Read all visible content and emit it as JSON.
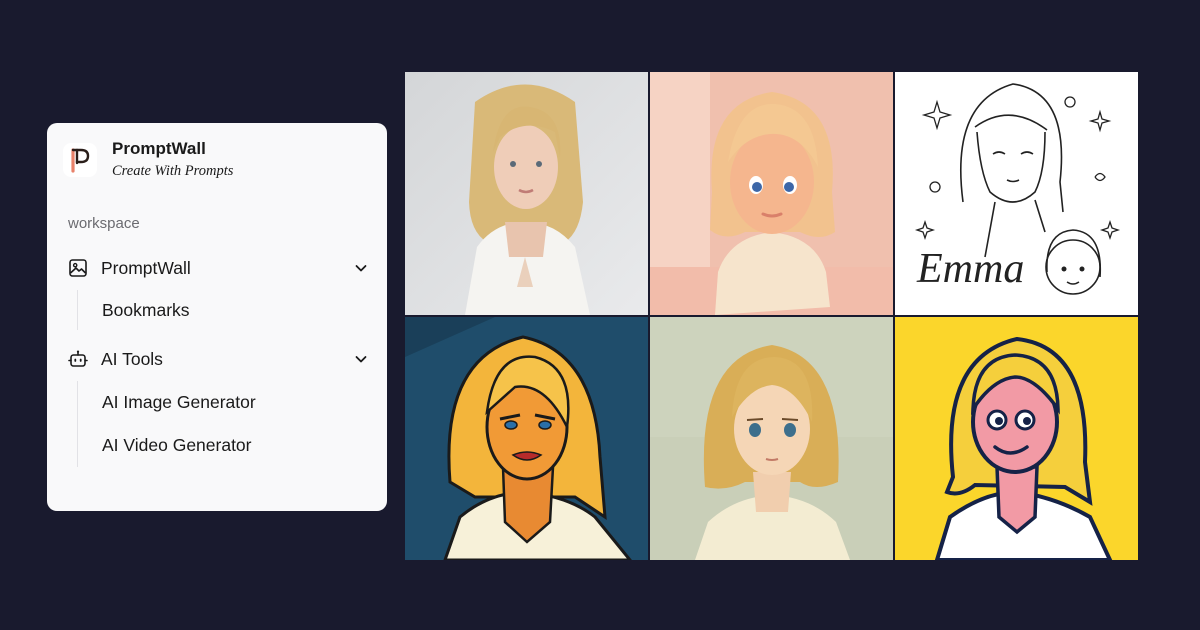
{
  "brand": {
    "name": "PromptWall",
    "tagline": "Create With Prompts",
    "logo_icon": "promptwall-p-logo",
    "accent_color": "#e8826b"
  },
  "sidebar": {
    "section_label": "workspace",
    "groups": [
      {
        "label": "PromptWall",
        "icon": "image-icon",
        "expanded": true,
        "items": [
          {
            "label": "Bookmarks"
          }
        ]
      },
      {
        "label": "AI Tools",
        "icon": "robot-icon",
        "expanded": true,
        "items": [
          {
            "label": "AI Image Generator"
          },
          {
            "label": "AI Video Generator"
          }
        ]
      }
    ]
  },
  "gallery": {
    "tiles": [
      {
        "style": "photo-portrait"
      },
      {
        "style": "clay-3d"
      },
      {
        "style": "line-art",
        "caption": "Emma"
      },
      {
        "style": "pop-art"
      },
      {
        "style": "anime"
      },
      {
        "style": "flat-cartoon"
      }
    ]
  },
  "colors": {
    "page_background": "#191a2e",
    "card_background": "#f9f9fa"
  }
}
